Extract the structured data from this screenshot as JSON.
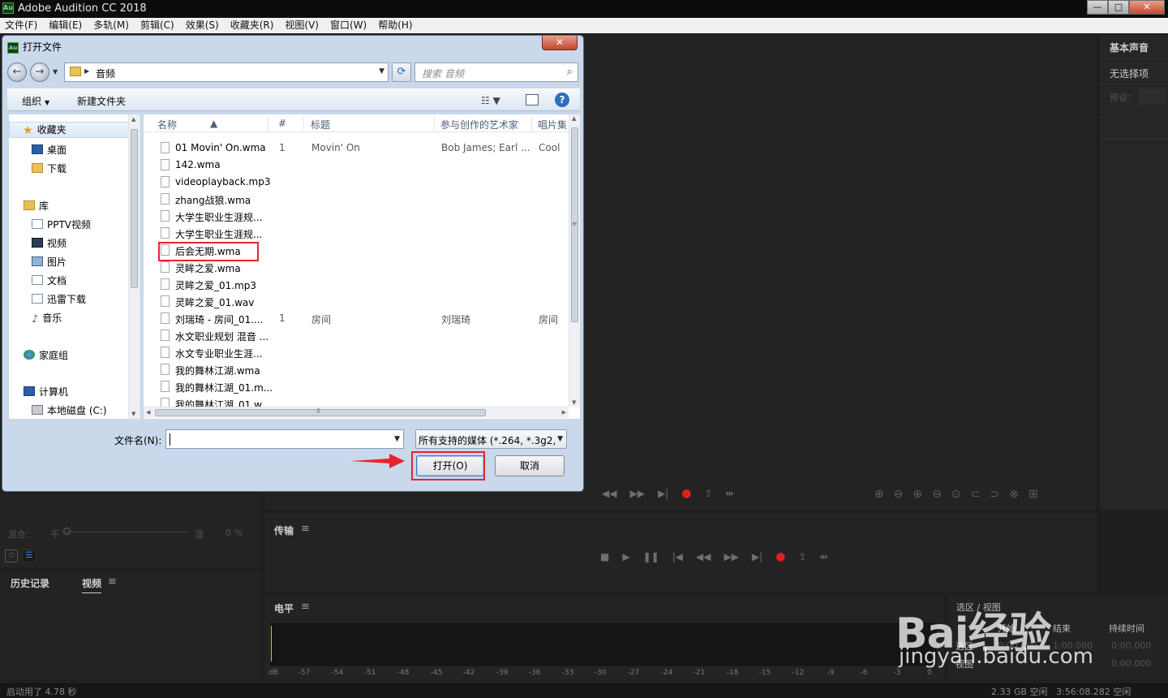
{
  "app": {
    "title": "Adobe Audition CC 2018",
    "icon_label": "Au",
    "window_buttons": [
      "—",
      "□",
      "✕"
    ]
  },
  "menu": [
    "文件(F)",
    "编辑(E)",
    "多轨(M)",
    "剪辑(C)",
    "效果(S)",
    "收藏夹(R)",
    "视图(V)",
    "窗口(W)",
    "帮助(H)"
  ],
  "right_panel": {
    "title": "基本声音",
    "no_selection": "无选择项",
    "preset": "预设："
  },
  "left_mixer": {
    "mix_label": "混合：",
    "dry": "干",
    "wet": "湿",
    "percent": "0 %"
  },
  "bottom_tabs": {
    "history": "历史记录",
    "video": "视频"
  },
  "transport": {
    "title": "传输"
  },
  "level": {
    "title": "电平",
    "scale": [
      "dB",
      "-57",
      "-54",
      "-51",
      "-48",
      "-45",
      "-42",
      "-39",
      "-36",
      "-33",
      "-30",
      "-27",
      "-24",
      "-21",
      "-18",
      "-15",
      "-12",
      "-9",
      "-6",
      "-3",
      "0"
    ]
  },
  "selection_panel": {
    "title": "选区 / 视图",
    "col_start": "开始",
    "col_end": "结束",
    "col_duration": "持续时间",
    "row_selection": "选区",
    "row_view": "视图",
    "start_value": "0:00.000",
    "end_value": "1:00.000",
    "duration_value": "0:00.000"
  },
  "status": {
    "startup": "启动用了 4.78 秒",
    "disk_free": "2.33 GB 空闲",
    "time_free": "3:56:08.282 空闲"
  },
  "dialog": {
    "title": "打开文件",
    "close": "✕",
    "breadcrumb": "音频",
    "search_placeholder": "搜索 音频",
    "organize": "组织",
    "new_folder": "新建文件夹",
    "nav": {
      "favorites": "收藏夹",
      "desktop": "桌面",
      "downloads": "下载",
      "libraries": "库",
      "pptv": "PPTV视频",
      "videos": "视频",
      "pictures": "图片",
      "documents": "文档",
      "thunder": "迅雷下载",
      "music": "音乐",
      "homegroup": "家庭组",
      "computer": "计算机",
      "local_disk": "本地磁盘 (C:)"
    },
    "columns": {
      "name": "名称",
      "num": "#",
      "title": "标题",
      "artist": "参与创作的艺术家",
      "album": "唱片集"
    },
    "files": [
      {
        "name": "01 Movin' On.wma",
        "num": "1",
        "title": "Movin' On",
        "artist": "Bob James; Earl ...",
        "album": "Cool"
      },
      {
        "name": "142.wma",
        "num": "",
        "title": "",
        "artist": "",
        "album": ""
      },
      {
        "name": "videoplayback.mp3",
        "num": "",
        "title": "",
        "artist": "",
        "album": ""
      },
      {
        "name": "zhang战狼.wma",
        "num": "",
        "title": "",
        "artist": "",
        "album": ""
      },
      {
        "name": "大学生职业生涯规...",
        "num": "",
        "title": "",
        "artist": "",
        "album": ""
      },
      {
        "name": "大学生职业生涯规...",
        "num": "",
        "title": "",
        "artist": "",
        "album": ""
      },
      {
        "name": "后会无期.wma",
        "num": "",
        "title": "",
        "artist": "",
        "album": ""
      },
      {
        "name": "灵眸之爱.wma",
        "num": "",
        "title": "",
        "artist": "",
        "album": ""
      },
      {
        "name": "灵眸之爱_01.mp3",
        "num": "",
        "title": "",
        "artist": "",
        "album": ""
      },
      {
        "name": "灵眸之爱_01.wav",
        "num": "",
        "title": "",
        "artist": "",
        "album": ""
      },
      {
        "name": "刘瑞琦 - 房间_01....",
        "num": "1",
        "title": "房间",
        "artist": "刘瑞琦",
        "album": "房间"
      },
      {
        "name": "水文职业规划 混音 ...",
        "num": "",
        "title": "",
        "artist": "",
        "album": ""
      },
      {
        "name": "水文专业职业生涯...",
        "num": "",
        "title": "",
        "artist": "",
        "album": ""
      },
      {
        "name": "我的舞林江湖.wma",
        "num": "",
        "title": "",
        "artist": "",
        "album": ""
      },
      {
        "name": "我的舞林江湖_01.m...",
        "num": "",
        "title": "",
        "artist": "",
        "album": ""
      },
      {
        "name": "我的舞林江湖_01.w...",
        "num": "",
        "title": "",
        "artist": "",
        "album": ""
      }
    ],
    "filename_label": "文件名(N):",
    "filename_value": "",
    "filetype": "所有支持的媒体 (*.264, *.3g2,",
    "open_button": "打开(O)",
    "cancel_button": "取消"
  },
  "watermark": {
    "logo": "Bai经验",
    "url": "jingyan.baidu.com"
  },
  "colors": {
    "highlight": "#e8242b",
    "record": "#e02020",
    "accent_blue": "#2d6fc0"
  }
}
